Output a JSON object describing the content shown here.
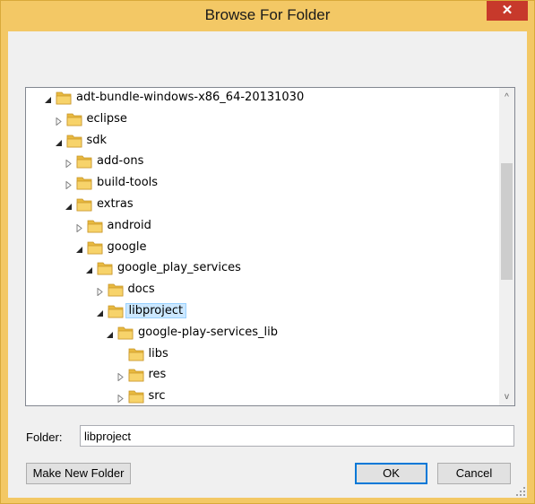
{
  "window": {
    "title": "Browse For Folder",
    "close_glyph": "✕"
  },
  "tree": {
    "items": [
      {
        "label": "adt-bundle-windows-x86_64-20131030",
        "expanded": true,
        "depth": 0,
        "selected": false,
        "expander": "expanded"
      },
      {
        "label": "eclipse",
        "expanded": false,
        "depth": 1,
        "selected": false,
        "expander": "collapsed"
      },
      {
        "label": "sdk",
        "expanded": true,
        "depth": 1,
        "selected": false,
        "expander": "expanded"
      },
      {
        "label": "add-ons",
        "expanded": false,
        "depth": 2,
        "selected": false,
        "expander": "collapsed"
      },
      {
        "label": "build-tools",
        "expanded": false,
        "depth": 2,
        "selected": false,
        "expander": "collapsed"
      },
      {
        "label": "extras",
        "expanded": true,
        "depth": 2,
        "selected": false,
        "expander": "expanded"
      },
      {
        "label": "android",
        "expanded": false,
        "depth": 3,
        "selected": false,
        "expander": "collapsed"
      },
      {
        "label": "google",
        "expanded": true,
        "depth": 3,
        "selected": false,
        "expander": "expanded"
      },
      {
        "label": "google_play_services",
        "expanded": true,
        "depth": 4,
        "selected": false,
        "expander": "expanded"
      },
      {
        "label": "docs",
        "expanded": false,
        "depth": 5,
        "selected": false,
        "expander": "collapsed"
      },
      {
        "label": "libproject",
        "expanded": true,
        "depth": 5,
        "selected": true,
        "expander": "expanded"
      },
      {
        "label": "google-play-services_lib",
        "expanded": true,
        "depth": 6,
        "selected": false,
        "expander": "expanded"
      },
      {
        "label": "libs",
        "expanded": false,
        "depth": 7,
        "selected": false,
        "expander": "none"
      },
      {
        "label": "res",
        "expanded": false,
        "depth": 7,
        "selected": false,
        "expander": "collapsed"
      },
      {
        "label": "src",
        "expanded": false,
        "depth": 7,
        "selected": false,
        "expander": "collapsed"
      }
    ]
  },
  "scrollbar": {
    "up_glyph": "^",
    "down_glyph": "v"
  },
  "folder_field": {
    "label": "Folder:",
    "value": "libproject"
  },
  "buttons": {
    "make_new_folder": "Make New Folder",
    "ok": "OK",
    "cancel": "Cancel"
  },
  "colors": {
    "title_bar": "#f3c865",
    "close_button": "#c7392b",
    "selection": "#cce8ff",
    "folder_yellow": "#f7d36a"
  },
  "icons": {
    "folder": "folder-icon",
    "expanded": "triangle-expanded-icon",
    "collapsed": "triangle-collapsed-icon",
    "close": "close-icon",
    "grip": "resize-grip-icon"
  }
}
